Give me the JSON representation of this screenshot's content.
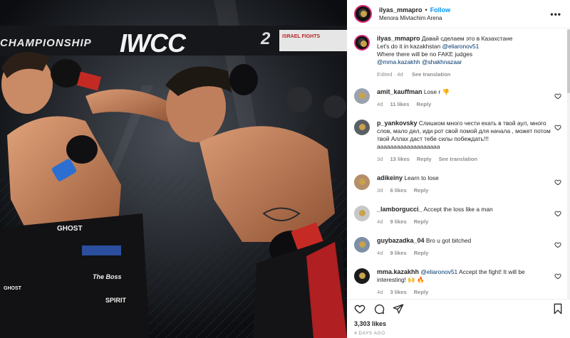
{
  "photo": {
    "banner_left": "CHAMPIONSHIP",
    "banner_center": "IWCC",
    "banner_right_num": "2",
    "banner_right_small": "ISRAEL FIGHTS",
    "trunk_brand": "GHOST",
    "trunk_brand_2": "GHOST",
    "trunk_sponsor": "SPIRIT",
    "trunk_nick": "The Boss"
  },
  "post": {
    "username": "ilyas_mmapro",
    "follow_label": "Follow",
    "location": "Menora Mivtachim Arena",
    "caption": {
      "username": "ilyas_mmapro",
      "line1": "Давай сделаем это в Казахстане",
      "line2_prefix": "Let's do it in kazakhstan ",
      "line2_mention": "@eliaronov51",
      "line3": "Where there will be no FAKE judges",
      "line4_mention1": "@mma.kazakhh",
      "line4_mention2": "@shakhnazaar",
      "meta_edited": "Edited · 4d",
      "meta_translation": "See translation"
    },
    "comments": [
      {
        "user": "amit_kauffman",
        "text": "Lose r 👎",
        "age": "4d",
        "likes": "11 likes",
        "reply": "Reply",
        "translation": ""
      },
      {
        "user": "p_yankovsky",
        "text": "Слишком много чести ехать в твой аул, много слов, мало дел, иди рот свой помой для начала , может потом твой Аллах даст тебе силы побеждать!!! ааааааааааааааааааа",
        "age": "3d",
        "likes": "13 likes",
        "reply": "Reply",
        "translation": "See translation"
      },
      {
        "user": "adikeiny",
        "text": "Learn to lose",
        "age": "3d",
        "likes": "6 likes",
        "reply": "Reply",
        "translation": ""
      },
      {
        "user": "_lamborgucci_",
        "text": "Accept the loss like a man",
        "age": "4d",
        "likes": "9 likes",
        "reply": "Reply",
        "translation": ""
      },
      {
        "user": "guybazadka_04",
        "text": "Bro u got bitched",
        "age": "4d",
        "likes": "9 likes",
        "reply": "Reply",
        "translation": ""
      },
      {
        "user": "mma.kazakhh",
        "mention": "@eliaronov51",
        "text": " Accept the fight! It will be interesting! 🙌 🔥",
        "age": "4d",
        "likes": "3 likes",
        "reply": "Reply",
        "translation": ""
      }
    ],
    "likes_count": "3,303 likes",
    "date": "4 DAYS AGO"
  },
  "colors": {
    "link": "#0095f6",
    "mention": "#00376b",
    "muted": "#8e8e8e",
    "text": "#262626",
    "ring": "#d62976"
  }
}
